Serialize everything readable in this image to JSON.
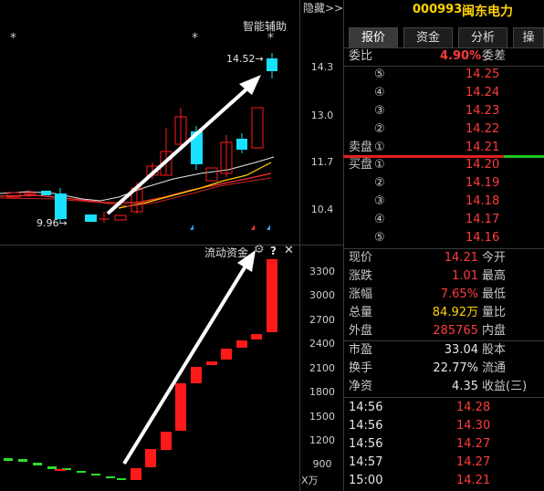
{
  "header": {
    "hide_label": "隐藏>>",
    "code": "000993",
    "name": "闽东电力"
  },
  "tabs": [
    "报价",
    "资金",
    "分析",
    "操"
  ],
  "kline": {
    "indicator_title": "智能辅助",
    "high_label": "14.52",
    "low_label": "9.96",
    "y_ticks": [
      "14.3",
      "13.0",
      "11.7",
      "10.4"
    ]
  },
  "flow": {
    "title": "流动资金",
    "settings_icon": "gear-icon",
    "help_icon": "question-icon",
    "close_icon": "close-icon",
    "y_ticks": [
      "3300",
      "3000",
      "2700",
      "2400",
      "2100",
      "1800",
      "1500",
      "1200",
      "900"
    ],
    "unit": "X万"
  },
  "order_book": {
    "webi_label": "委比",
    "webi_value": "4.90%",
    "weicha_label": "委差",
    "sell_label": "卖盘",
    "buy_label": "买盘",
    "sell": [
      {
        "level": "⑤",
        "price": "14.25"
      },
      {
        "level": "④",
        "price": "14.24"
      },
      {
        "level": "③",
        "price": "14.23"
      },
      {
        "level": "②",
        "price": "14.22"
      },
      {
        "level": "①",
        "price": "14.21"
      }
    ],
    "buy": [
      {
        "level": "①",
        "price": "14.20"
      },
      {
        "level": "②",
        "price": "14.19"
      },
      {
        "level": "③",
        "price": "14.18"
      },
      {
        "level": "④",
        "price": "14.17"
      },
      {
        "level": "⑤",
        "price": "14.16"
      }
    ]
  },
  "quote": [
    {
      "label": "现价",
      "value": "14.21",
      "color": "#ff3b3b",
      "label2": "今开"
    },
    {
      "label": "涨跌",
      "value": "1.01",
      "color": "#ff3b3b",
      "label2": "最高"
    },
    {
      "label": "涨幅",
      "value": "7.65%",
      "color": "#ff3b3b",
      "label2": "最低"
    },
    {
      "label": "总量",
      "value": "84.92万",
      "color": "#ffd400",
      "label2": "量比"
    },
    {
      "label": "外盘",
      "value": "285765",
      "color": "#ff3b3b",
      "label2": "内盘"
    },
    {
      "label": "市盈",
      "value": "33.04",
      "color": "#e6e6e6",
      "label2": "股本"
    },
    {
      "label": "换手",
      "value": "22.77%",
      "color": "#e6e6e6",
      "label2": "流通"
    },
    {
      "label": "净资",
      "value": "4.35",
      "color": "#e6e6e6",
      "label2": "收益(三)"
    }
  ],
  "trades": [
    {
      "time": "14:56",
      "price": "14.28"
    },
    {
      "time": "14:56",
      "price": "14.30"
    },
    {
      "time": "14:56",
      "price": "14.27"
    },
    {
      "time": "14:57",
      "price": "14.27"
    },
    {
      "time": "15:00",
      "price": "14.21"
    }
  ],
  "colors": {
    "up": "#ff1a1a",
    "down": "#18e0ff",
    "flow_up": "#ff1a1a",
    "flow_down": "#2be02b",
    "arrow": "#ffffff"
  }
}
